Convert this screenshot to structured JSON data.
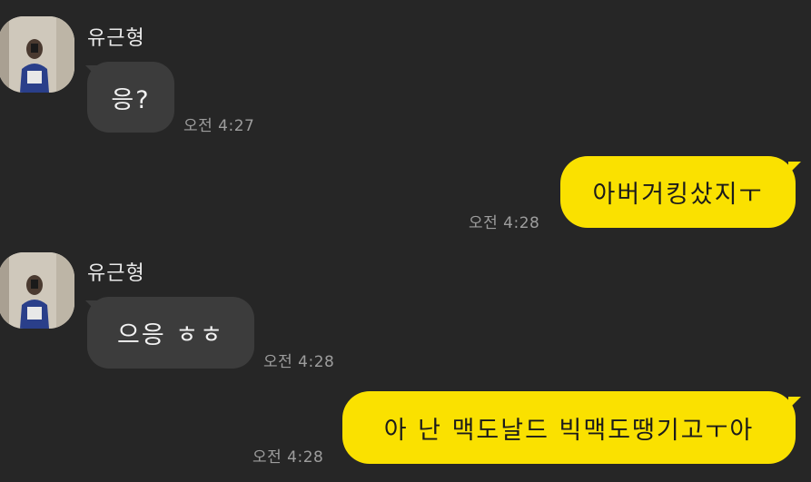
{
  "messages": [
    {
      "direction": "incoming",
      "sender": "유근형",
      "text": "응?",
      "time": "오전 4:27"
    },
    {
      "direction": "outgoing",
      "text": "아버거킹샀지ㅜ",
      "time": "오전 4:28"
    },
    {
      "direction": "incoming",
      "sender": "유근형",
      "text": "으응 ㅎㅎ",
      "time": "오전 4:28"
    },
    {
      "direction": "outgoing",
      "text": "아 난 맥도날드 빅맥도땡기고ㅜ아",
      "time": "오전 4:28"
    }
  ],
  "colors": {
    "background": "#262626",
    "incoming_bubble": "#3c3c3c",
    "outgoing_bubble": "#fae100",
    "timestamp": "#9d9d9d"
  }
}
